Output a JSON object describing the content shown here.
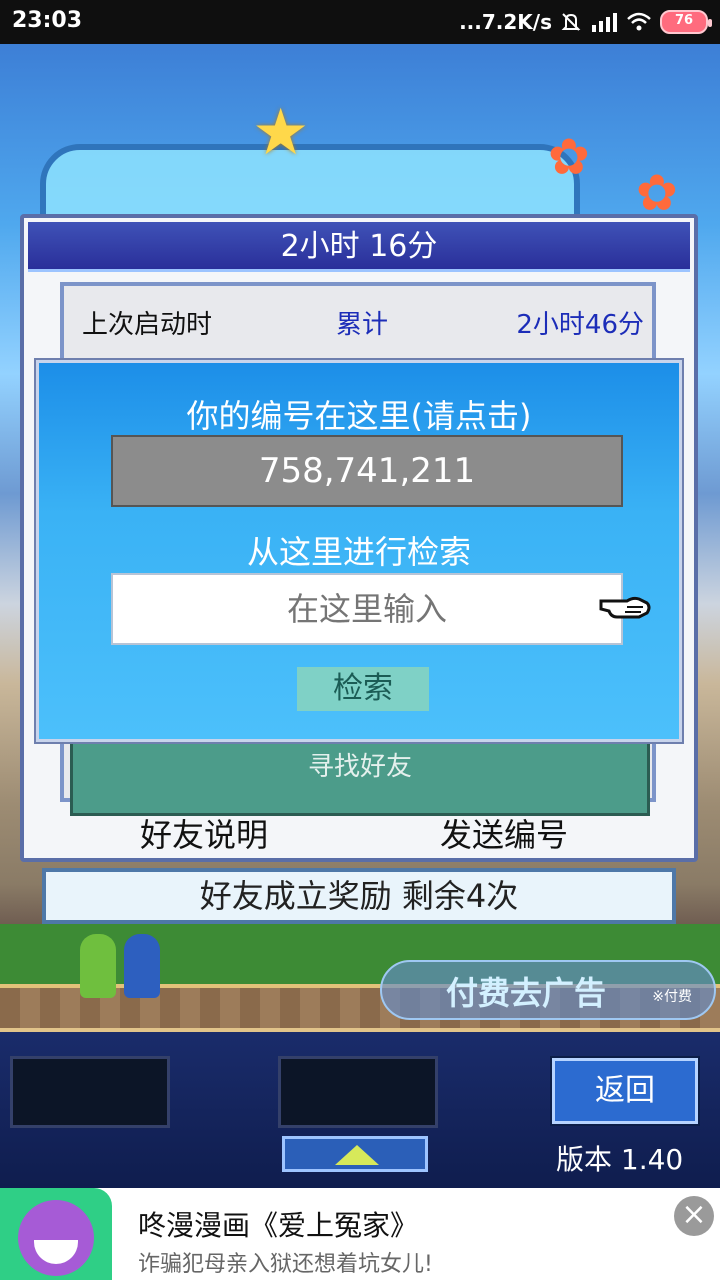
{
  "status_bar": {
    "time": "23:03",
    "network_speed": "...7.2K/s",
    "battery_level": "76",
    "icons": [
      "mute-icon",
      "signal-icon",
      "wifi-icon",
      "battery-icon"
    ]
  },
  "friend_panel": {
    "title": "2小时 16分",
    "last_launch_label": "上次启动时",
    "cumulative_label": "累计",
    "cumulative_value": "2小时46分",
    "find_friends_label": "寻找好友",
    "friend_help_button": "好友说明",
    "send_id_button": "发送编号"
  },
  "id_dialog": {
    "prompt": "你的编号在这里(请点击)",
    "id_number": "758,741,211",
    "search_title": "从这里进行检索",
    "search_placeholder": "在这里输入",
    "search_button": "检索"
  },
  "reward_bar": {
    "text": "好友成立奖励  剩余4次"
  },
  "ad_removal": {
    "label": "付费去广告",
    "sub_label": "※付费"
  },
  "bottom_dock": {
    "back_button": "返回",
    "version": "版本 1.40"
  },
  "ad_banner": {
    "title": "咚漫漫画《爱上冤家》",
    "subtitle": "诈骗犯母亲入狱还想着坑女儿!"
  },
  "colors": {
    "panel_title_bg": "#2a2f9a",
    "dialog_bg": "#3ab2f5",
    "id_box_bg": "#8c8c8c",
    "highlight_blue_text": "#1c2db8",
    "search_button_bg": "#7fd1c6"
  }
}
